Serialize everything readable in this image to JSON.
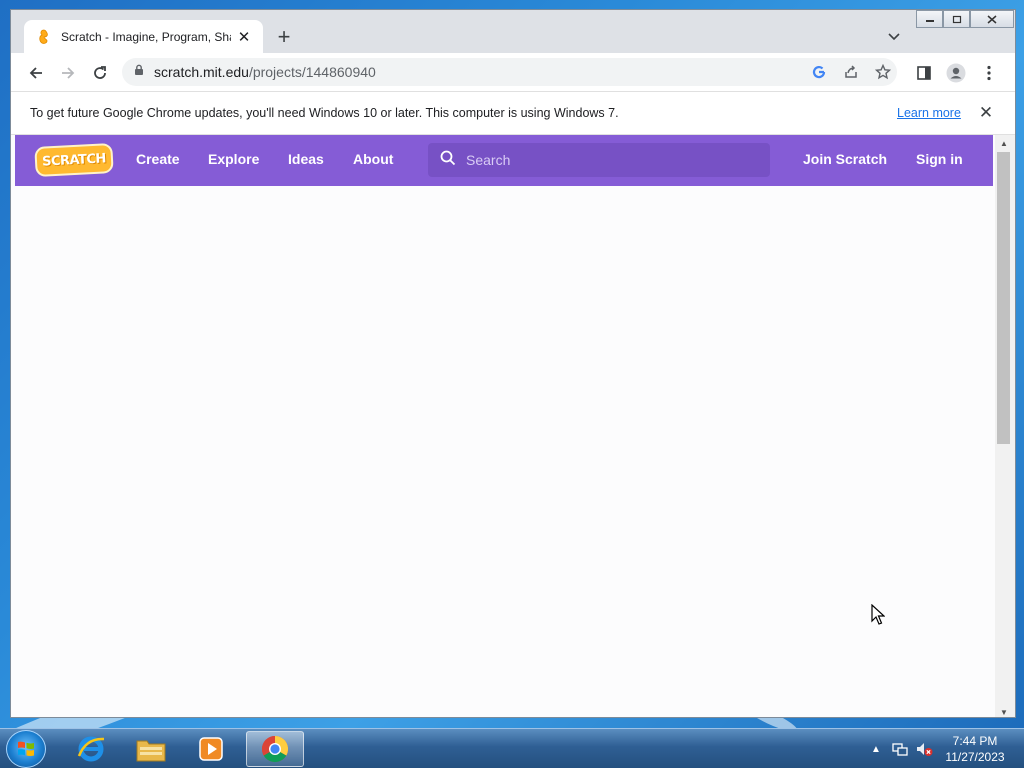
{
  "browser": {
    "tab": {
      "title": "Scratch - Imagine, Program, Share",
      "favicon": "scratch-cat-icon"
    },
    "new_tab_label": "+",
    "url": {
      "host": "scratch.mit.edu",
      "path": "/projects/144860940"
    }
  },
  "infobar": {
    "message": "To get future Google Chrome updates, you'll need Windows 10 or later. This computer is using Windows 7.",
    "link": "Learn more"
  },
  "scratch": {
    "logo_text": "SCRATCH",
    "nav": {
      "create": "Create",
      "explore": "Explore",
      "ideas": "Ideas",
      "about": "About"
    },
    "search_placeholder": "Search",
    "join": "Join Scratch",
    "signin": "Sign in",
    "brand_color": "#855cd6"
  },
  "taskbar": {
    "time": "7:44 PM",
    "date": "11/27/2023",
    "apps": [
      "internet-explorer-icon",
      "file-explorer-icon",
      "media-player-icon",
      "chrome-icon"
    ]
  }
}
